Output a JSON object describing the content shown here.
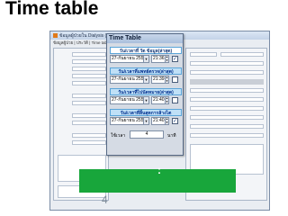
{
  "slide": {
    "title": "Time table"
  },
  "app": {
    "window_title": "ข้อมูลผู้ป่วยใน Dialysis (Time table)",
    "menu": "ข้อมูลผู้ป่วย  |  ประวัติ  |  Time table"
  },
  "dialog": {
    "title": "Time Table",
    "sections": [
      {
        "label": "วัน/เวลาที่ วัด ข้อมูล(ล่าสุด)",
        "date": "27-กันยายน 2555",
        "time": "21:36",
        "checked": true
      },
      {
        "label": "วัน/เวลาที่แพทย์ตรวจ(ล่าสุด)",
        "date": "27-กันยายน 2555",
        "time": "21:39",
        "checked": false
      },
      {
        "label": "วัน/เวลาที่ไปนัดหมาย(ล่าสุด)",
        "date": "27-กันยายน 2555",
        "time": "21:40",
        "checked": false
      },
      {
        "label": "วัน/เวลาที่สิ้นสุดการล้างไต",
        "date": "27-กันยายน 2555",
        "time": "21:40",
        "checked": true
      }
    ],
    "used_time": {
      "label": "ใช้เวลา",
      "value": "4",
      "unit": "นาที"
    }
  },
  "overlay": {
    "colon": ":",
    "bottom_number": "4"
  },
  "colors": {
    "green": "#18a63b",
    "section_head": "#00308f"
  }
}
